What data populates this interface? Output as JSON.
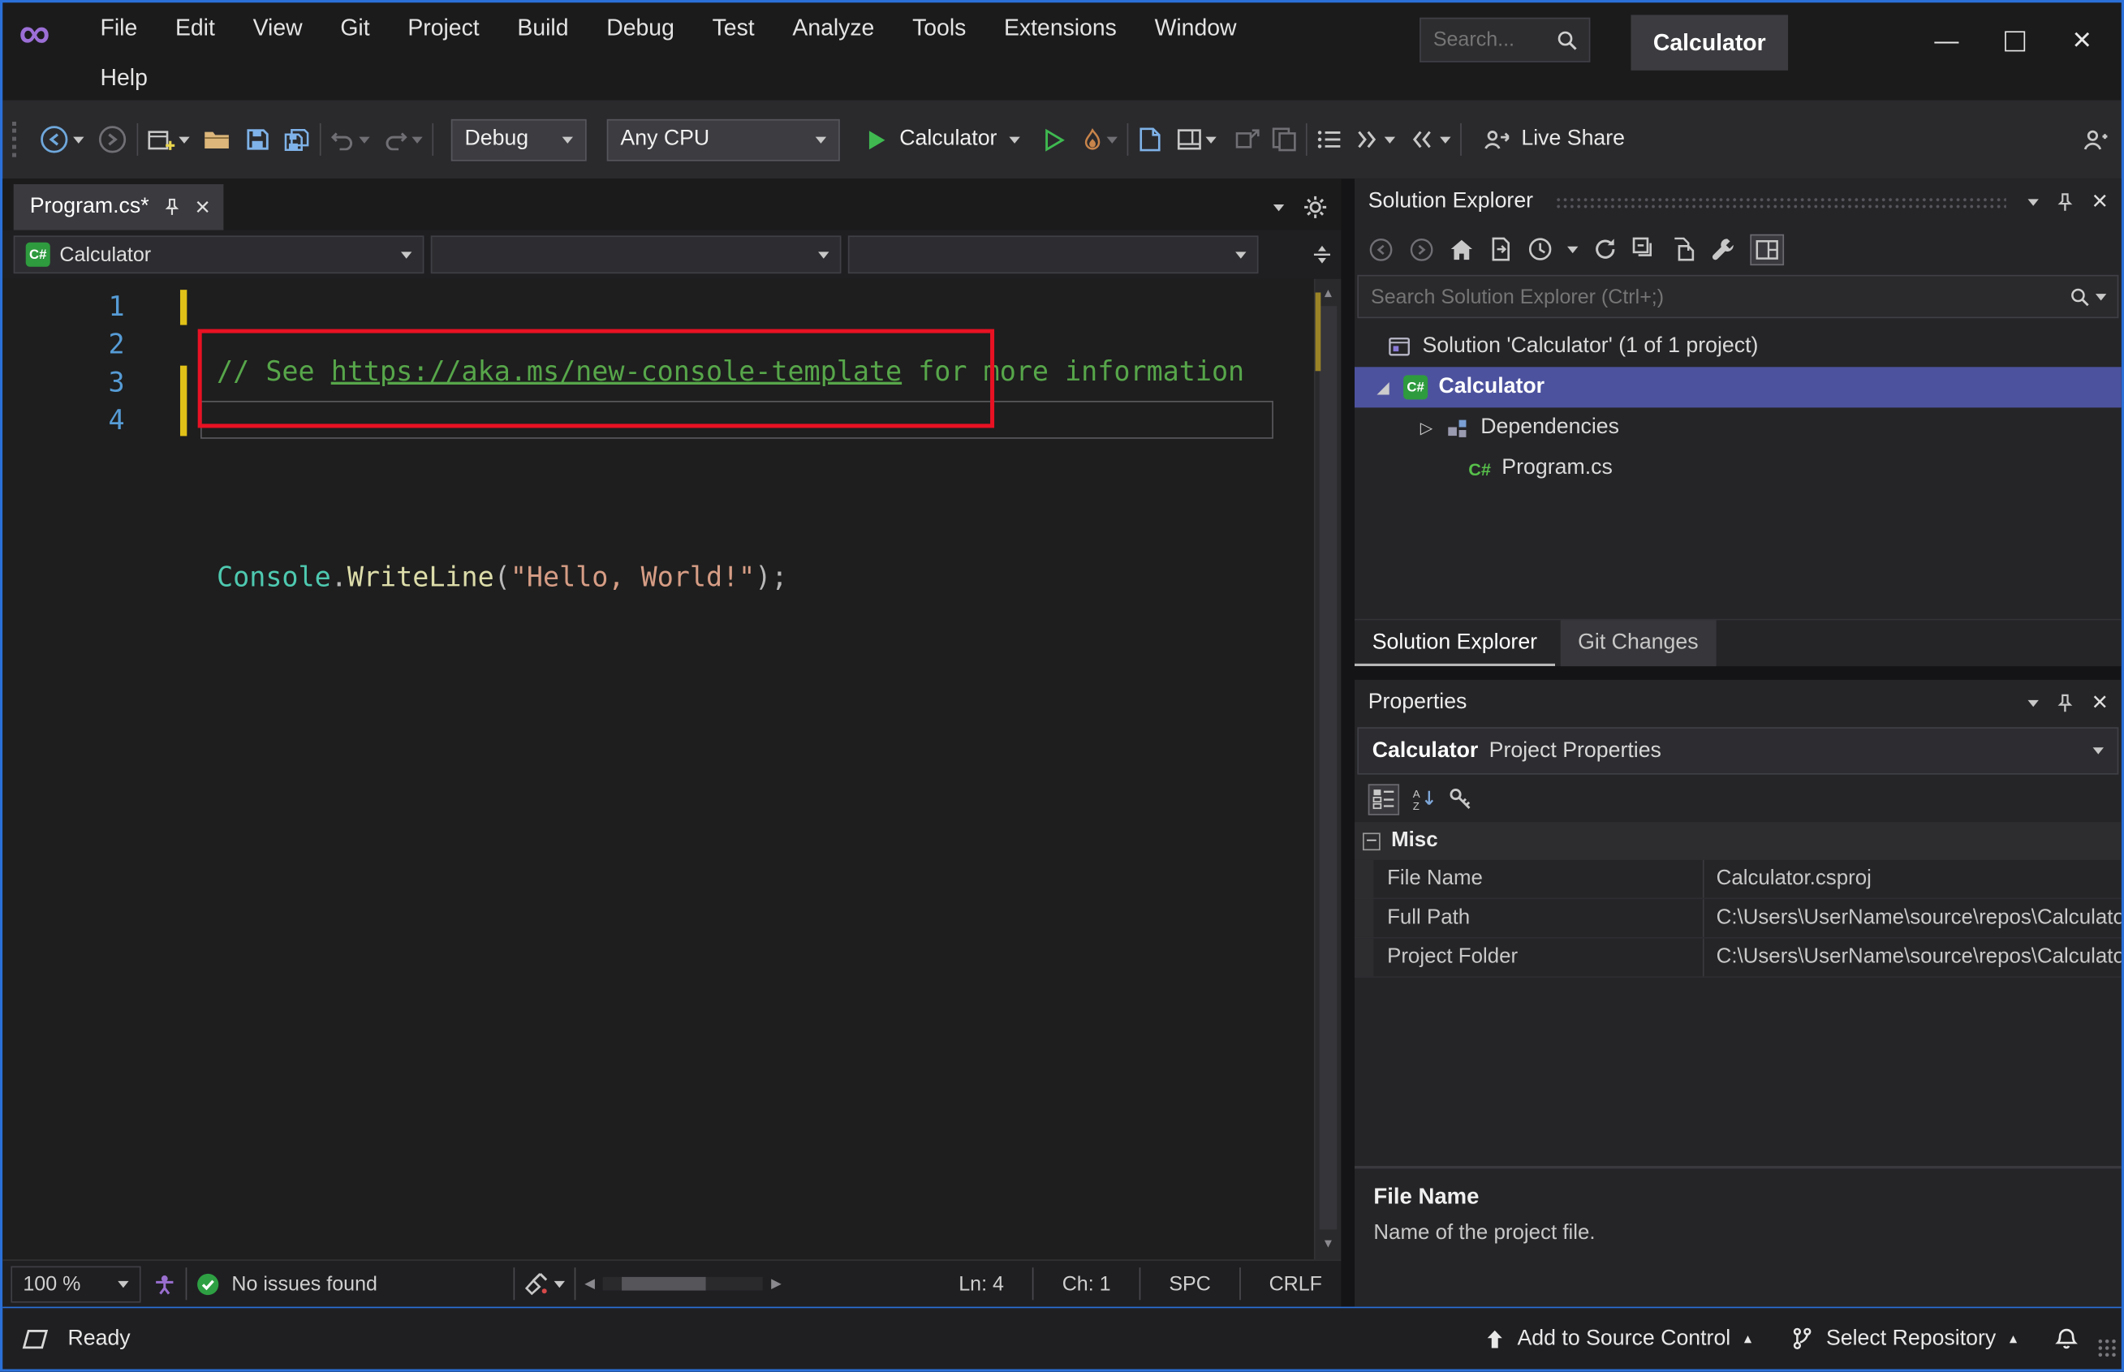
{
  "colors": {
    "window_border_accent": "#2a70d8",
    "selection_highlight": "#4d529e",
    "annotation_red": "#e81123",
    "run_green": "#3fb950",
    "comment_green": "#57a64a",
    "type_teal": "#4ec9b0",
    "method_yellow": "#dcdcaa",
    "string_orange": "#d69d85",
    "line_number_blue": "#569cd6",
    "modified_line_yellow": "#e1c117"
  },
  "glyphs": {
    "minimize": "—",
    "close": "×",
    "tree_expanded": "◢",
    "tree_collapsed": "▷",
    "scroll_up": "▲",
    "scroll_down": "▼",
    "scroll_left": "◀",
    "scroll_right": "▶",
    "menu_up": "▴",
    "csharp": "C#"
  },
  "titlebar": {
    "menu": [
      "File",
      "Edit",
      "View",
      "Git",
      "Project",
      "Build",
      "Debug",
      "Test",
      "Analyze",
      "Tools",
      "Extensions",
      "Window",
      "Help"
    ],
    "search_placeholder": "Search...",
    "window_title": "Calculator"
  },
  "toolbar": {
    "configuration": "Debug",
    "platform": "Any CPU",
    "run_target": "Calculator",
    "live_share": "Live Share"
  },
  "editor": {
    "tab_title": "Program.cs*",
    "nav_project": "Calculator",
    "line_numbers": [
      "1",
      "2",
      "3",
      "4"
    ],
    "code_lines": {
      "l1": {
        "c1": "// See ",
        "link": "https://aka.ms/new-console-template",
        "c2": " for more information"
      },
      "l3": {
        "type": "Console",
        "dot": ".",
        "method": "WriteLine",
        "open": "(",
        "string": "\"Hello, World!\"",
        "close": ")",
        "semi": ";"
      }
    },
    "status": {
      "zoom": "100 %",
      "issues": "No issues found",
      "ln": "Ln: 4",
      "ch": "Ch: 1",
      "encoding": "SPC",
      "line_ending": "CRLF"
    }
  },
  "solution_explorer": {
    "title": "Solution Explorer",
    "search_placeholder": "Search Solution Explorer (Ctrl+;)",
    "tree": {
      "solution": "Solution 'Calculator' (1 of 1 project)",
      "project": "Calculator",
      "dependencies": "Dependencies",
      "file": "Program.cs"
    },
    "tabs": {
      "solution_explorer": "Solution Explorer",
      "git_changes": "Git Changes"
    }
  },
  "properties": {
    "title": "Properties",
    "object_name": "Calculator",
    "object_type": "Project Properties",
    "category": "Misc",
    "rows": [
      {
        "name": "File Name",
        "value": "Calculator.csproj"
      },
      {
        "name": "Full Path",
        "value": "C:\\Users\\UserName\\source\\repos\\Calculator"
      },
      {
        "name": "Project Folder",
        "value": "C:\\Users\\UserName\\source\\repos\\Calculator"
      }
    ],
    "description_title": "File Name",
    "description_text": "Name of the project file."
  },
  "statusbar": {
    "ready": "Ready",
    "add_source_control": "Add to Source Control",
    "select_repository": "Select Repository"
  }
}
